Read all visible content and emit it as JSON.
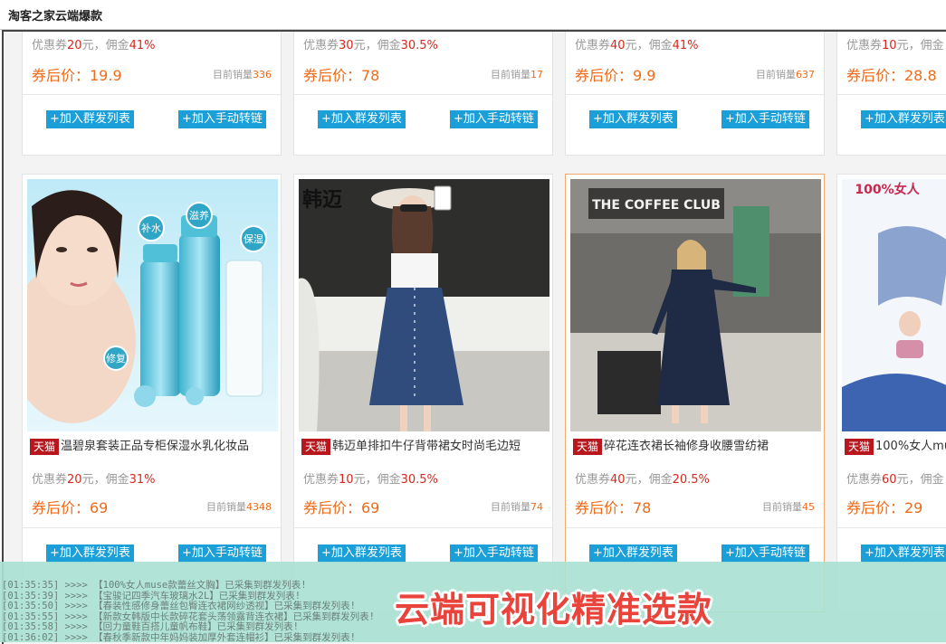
{
  "window": {
    "title": "淘客之家云端爆款"
  },
  "top_row": [
    {
      "coupon_prefix": "优惠券",
      "coupon_value": "20",
      "coupon_unit": "元，佣金",
      "commission": "41%",
      "price": "券后价：19.9",
      "sales_label": "目前销量",
      "sales": "336",
      "btn_group": "+加入群发列表",
      "btn_manual": "+加入手动转链"
    },
    {
      "coupon_prefix": "优惠券",
      "coupon_value": "30",
      "coupon_unit": "元，佣金",
      "commission": "30.5%",
      "price": "券后价：78",
      "sales_label": "目前销量",
      "sales": "17",
      "btn_group": "+加入群发列表",
      "btn_manual": "+加入手动转链"
    },
    {
      "coupon_prefix": "优惠券",
      "coupon_value": "40",
      "coupon_unit": "元，佣金",
      "commission": "41%",
      "price": "券后价：9.9",
      "sales_label": "目前销量",
      "sales": "637",
      "btn_group": "+加入群发列表",
      "btn_manual": "+加入手动转链"
    },
    {
      "coupon_prefix": "优惠券",
      "coupon_value": "10",
      "coupon_unit": "元，佣金",
      "commission": "",
      "price": "券后价：28.8",
      "sales_label": "",
      "sales": "",
      "btn_group": "+加入群发列表",
      "btn_manual": ""
    }
  ],
  "products": [
    {
      "badge": "天猫",
      "title": "温碧泉套装正品专柜保湿水乳化妆品",
      "coupon_prefix": "优惠券",
      "coupon_value": "20",
      "coupon_unit": "元，佣金",
      "commission": "31%",
      "price": "券后价：69",
      "sales_label": "目前销量",
      "sales": "4348",
      "btn_group": "+加入群发列表",
      "btn_manual": "+加入手动转链",
      "image_labels": [
        "补水",
        "滋养",
        "保湿",
        "修复"
      ]
    },
    {
      "badge": "天猫",
      "title": "韩迈单排扣牛仔背带裙女时尚毛边短",
      "coupon_prefix": "优惠券",
      "coupon_value": "10",
      "coupon_unit": "元，佣金",
      "commission": "30.5%",
      "price": "券后价：69",
      "sales_label": "目前销量",
      "sales": "74",
      "btn_group": "+加入群发列表",
      "btn_manual": "+加入手动转链",
      "image_labels": [
        "韩迈"
      ]
    },
    {
      "badge": "天猫",
      "title": "碎花连衣裙长袖修身收腰雪纺裙",
      "coupon_prefix": "优惠券",
      "coupon_value": "40",
      "coupon_unit": "元，佣金",
      "commission": "20.5%",
      "price": "券后价：78",
      "sales_label": "目前销量",
      "sales": "45",
      "btn_group": "+加入群发列表",
      "btn_manual": "+加入手动转链",
      "image_labels": [
        "THE COFFEE CLUB"
      ]
    },
    {
      "badge": "天猫",
      "title": "100%女人mu",
      "coupon_prefix": "优惠券",
      "coupon_value": "60",
      "coupon_unit": "元，佣金",
      "commission": "",
      "price": "券后价：29",
      "sales_label": "",
      "sales": "",
      "btn_group": "+加入群发列表",
      "btn_manual": "",
      "image_labels": [
        "100%女人"
      ]
    }
  ],
  "log_lines": [
    "[01:35:35] >>>> 【100%女人muse款蕾丝文胸】已采集到群发列表!",
    "[01:35:39] >>>> 【宝骏记四季汽车玻璃水2L】已采集到群发列表!",
    "[01:35:50] >>>> 【春装性感修身蕾丝包臀连衣裙网纱透视】已采集到群发列表!",
    "[01:35:55] >>>> 【新款女韩版中长款碎花套头荡领露背连衣裙】已采集到群发列表!",
    "[01:35:58] >>>> 【回力童鞋百搭儿童帆布鞋】已采集到群发列表!",
    "[01:36:02] >>>> 【春秋季新款中年妈妈装加厚外套连帽衫】已采集到群发列表!"
  ],
  "banner": "云端可视化精准选款",
  "colors": {
    "button": "#1a9fd9",
    "price": "#ee6b1a",
    "commission": "#d6281c",
    "tmall_badge": "#b8181d",
    "overlay": "#aae2d2",
    "banner_text": "#e8443c"
  }
}
